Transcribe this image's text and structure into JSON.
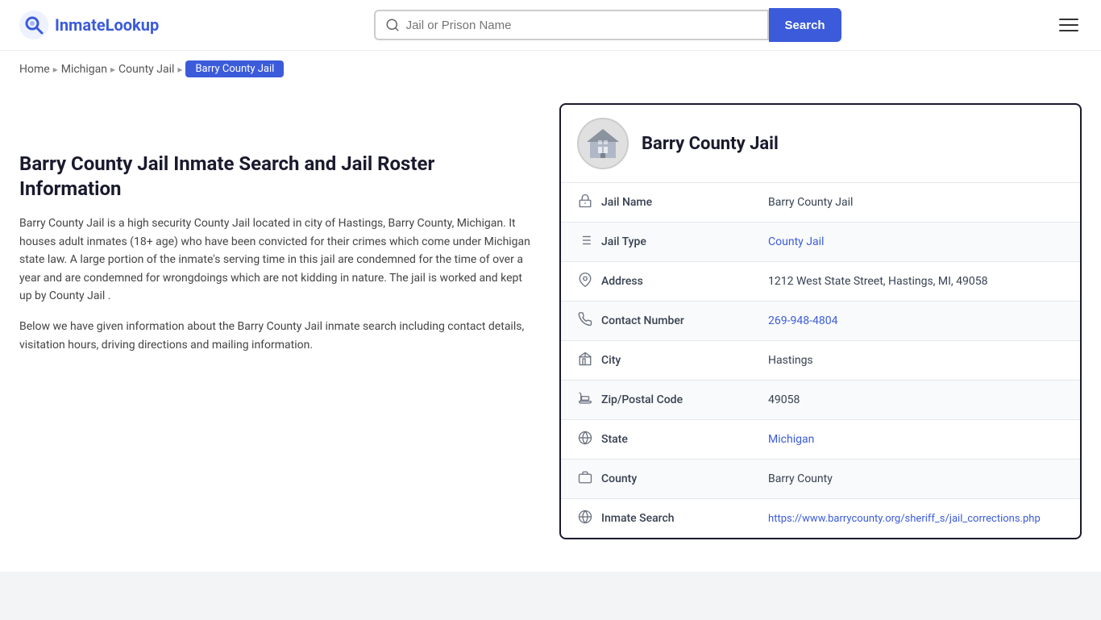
{
  "header": {
    "logo_text_part1": "Inmate",
    "logo_text_part2": "Lookup",
    "search_placeholder": "Jail or Prison Name",
    "search_button_label": "Search"
  },
  "breadcrumb": {
    "items": [
      {
        "label": "Home",
        "href": "#",
        "active": false
      },
      {
        "label": "Michigan",
        "href": "#",
        "active": false
      },
      {
        "label": "County Jail",
        "href": "#",
        "active": false
      },
      {
        "label": "Barry County Jail",
        "href": "#",
        "active": true
      }
    ]
  },
  "left": {
    "heading": "Barry County Jail Inmate Search and Jail Roster Information",
    "paragraph1": "Barry County Jail is a high security County Jail located in city of Hastings, Barry County, Michigan. It houses adult inmates (18+ age) who have been convicted for their crimes which come under Michigan state law. A large portion of the inmate's serving time in this jail are condemned for the time of over a year and are condemned for wrongdoings which are not kidding in nature. The jail is worked and kept up by County Jail .",
    "paragraph2": "Below we have given information about the Barry County Jail inmate search including contact details, visitation hours, driving directions and mailing information."
  },
  "card": {
    "title": "Barry County Jail",
    "rows": [
      {
        "icon": "jail-icon",
        "label": "Jail Name",
        "value": "Barry County Jail",
        "link": null
      },
      {
        "icon": "type-icon",
        "label": "Jail Type",
        "value": "County Jail",
        "link": "#"
      },
      {
        "icon": "address-icon",
        "label": "Address",
        "value": "1212 West State Street, Hastings, MI, 49058",
        "link": null
      },
      {
        "icon": "phone-icon",
        "label": "Contact Number",
        "value": "269-948-4804",
        "link": "tel:269-948-4804"
      },
      {
        "icon": "city-icon",
        "label": "City",
        "value": "Hastings",
        "link": null
      },
      {
        "icon": "zip-icon",
        "label": "Zip/Postal Code",
        "value": "49058",
        "link": null
      },
      {
        "icon": "state-icon",
        "label": "State",
        "value": "Michigan",
        "link": "#"
      },
      {
        "icon": "county-icon",
        "label": "County",
        "value": "Barry County",
        "link": null
      },
      {
        "icon": "web-icon",
        "label": "Inmate Search",
        "value": "https://www.barrycounty.org/sheriff_s/jail_corrections.php",
        "link": "https://www.barrycounty.org/sheriff_s/jail_corrections.php"
      }
    ]
  }
}
